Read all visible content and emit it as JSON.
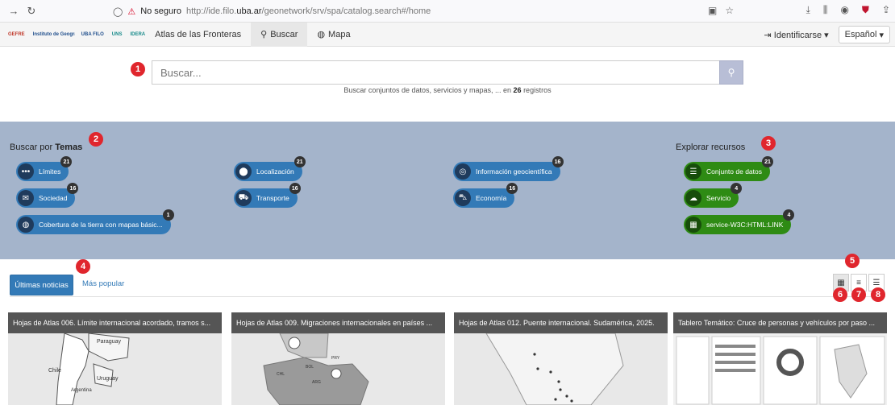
{
  "browser": {
    "insecure_label": "No seguro",
    "url_prefix": "http://ide.filo.",
    "url_host": "uba.ar",
    "url_suffix": "/geonetwork/srv/spa/catalog.search#/home"
  },
  "app": {
    "logos": [
      "GEFRE",
      "Instituto de Geografía \"Romualdo Ardissone\"",
      "UBA FILO",
      "UNS",
      "IDERA"
    ],
    "title": "Atlas de las Fronteras",
    "nav": [
      {
        "label": "Buscar",
        "icon": "search-icon"
      },
      {
        "label": "Mapa",
        "icon": "globe-icon"
      }
    ],
    "login_label": "Identificarse",
    "language": "Español"
  },
  "search": {
    "placeholder": "Buscar...",
    "hint_prefix": "Buscar conjuntos de datos, servicios y mapas, ... en",
    "hint_count": "26",
    "hint_suffix": "registros"
  },
  "markers": [
    "1",
    "2",
    "3",
    "4",
    "5",
    "6",
    "7",
    "8"
  ],
  "topics": {
    "title_prefix": "Buscar por",
    "title_bold": "Temas",
    "items": [
      {
        "label": "Límites",
        "count": "21",
        "icon": "ellipsis-icon"
      },
      {
        "label": "Localización",
        "count": "21",
        "icon": "map-marker-icon"
      },
      {
        "label": "Información geocientífica",
        "count": "16",
        "icon": "target-icon"
      },
      {
        "label": "Sociedad",
        "count": "16",
        "icon": "comments-icon"
      },
      {
        "label": "Transporte",
        "count": "16",
        "icon": "truck-icon"
      },
      {
        "label": "Economía",
        "count": "16",
        "icon": "cart-icon"
      },
      {
        "label": "Cobertura de la tierra con mapas básic...",
        "count": "1",
        "icon": "globe-icon"
      }
    ]
  },
  "resources": {
    "title": "Explorar recursos",
    "items": [
      {
        "label": "Conjunto de datos",
        "count": "21",
        "icon": "database-icon"
      },
      {
        "label": "Servicio",
        "count": "4",
        "icon": "cloud-icon"
      },
      {
        "label": "service-W3C:HTML:LINK",
        "count": "4",
        "icon": "table-icon"
      }
    ]
  },
  "tabs": {
    "active": "Últimas noticias",
    "other": "Más popular"
  },
  "view_buttons": [
    "grid-icon",
    "list-icon",
    "compact-list-icon"
  ],
  "cards": [
    {
      "title": "Hojas de Atlas 006. Límite internacional acordado, tramos s..."
    },
    {
      "title": "Hojas de Atlas 009. Migraciones internacionales en países ..."
    },
    {
      "title": "Hojas de Atlas 012. Puente internacional. Sudamérica, 2025."
    },
    {
      "title": "Tablero Temático: Cruce de personas y vehículos por paso ..."
    }
  ],
  "card_map_labels": {
    "card1": [
      "Paraguay",
      "Chile",
      "Uruguay",
      "Argentina"
    ],
    "card2": [
      "BOL",
      "PRY",
      "CHL",
      "ARG"
    ]
  }
}
